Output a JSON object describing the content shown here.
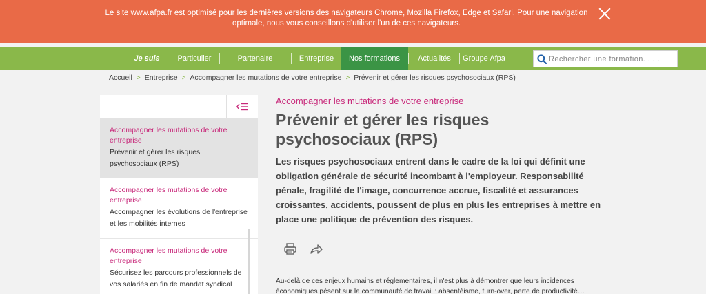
{
  "banner": {
    "message": "Le site www.afpa.fr est optimisé pour les dernières versions des navigateurs Chrome, Mozilla Firefox, Edge et Safari. Pour une navigation optimale, nous vous conseillons d'utiliser l'un de ces navigateurs."
  },
  "nav": {
    "je_suis": "Je suis",
    "particulier": "Particulier",
    "partenaire": "Partenaire",
    "entreprise": "Entreprise",
    "nos_formations": "Nos formations",
    "actualites": "Actualités",
    "groupe": "Groupe Afpa",
    "active_bg": "#3b9445",
    "bar_color": "#8ab84a"
  },
  "search": {
    "placeholder": "Rechercher une formation. . . ."
  },
  "breadcrumb": {
    "items": [
      "Accueil",
      "Entreprise",
      "Accompagner les mutations de votre entreprise",
      "Prévenir et gérer les risques psychosociaux (RPS)"
    ]
  },
  "sidebar": {
    "items": [
      {
        "category": "Accompagner les mutations de votre entreprise",
        "title": "Prévenir et gérer les risques psychosociaux (RPS)"
      },
      {
        "category": "Accompagner les mutations de votre entreprise",
        "title": "Accompagner les évolutions de l'entreprise et les mobilités internes"
      },
      {
        "category": "Accompagner les mutations de votre entreprise",
        "title": "Sécurisez les parcours professionnels de vos salariés en fin de mandat syndical"
      }
    ]
  },
  "main": {
    "category": "Accompagner les mutations de votre entreprise",
    "title": "Prévenir et gérer les risques psychosociaux (RPS)",
    "lead": "Les risques psychosociaux entrent dans le cadre de la loi qui définit une obligation générale de sécurité incombant à l'employeur. Responsabilité pénale, fragilité de l'image, concurrence accrue, fiscalité et assurances croissantes, accidents, poussent de plus en plus les entreprises à mettre en place une politique de prévention des risques.",
    "body": "Au-delà de ces enjeux humains et réglementaires, il n'est plus à démontrer que leurs incidences économiques pèsent sur la communauté de travail : absentéisme, turn-over, perte de productivité…"
  },
  "colors": {
    "banner": "#e96a47",
    "accent": "#c8287a"
  }
}
